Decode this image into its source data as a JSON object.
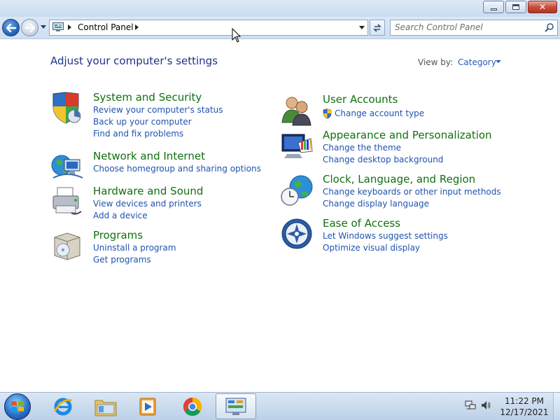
{
  "window": {
    "minimize_label": "",
    "maximize_label": "",
    "close_label": "✕"
  },
  "navbar": {
    "breadcrumb": "Control Panel",
    "search_placeholder": "Search Control Panel"
  },
  "content": {
    "heading": "Adjust your computer's settings",
    "view_by_label": "View by:",
    "view_by_value": "Category"
  },
  "categories_left": [
    {
      "title": "System and Security",
      "icon": "shield-icon",
      "links": [
        "Review your computer's status",
        "Back up your computer",
        "Find and fix problems"
      ]
    },
    {
      "title": "Network and Internet",
      "icon": "globe-network-icon",
      "links": [
        "Choose homegroup and sharing options"
      ]
    },
    {
      "title": "Hardware and Sound",
      "icon": "printer-icon",
      "links": [
        "View devices and printers",
        "Add a device"
      ]
    },
    {
      "title": "Programs",
      "icon": "programs-box-icon",
      "links": [
        "Uninstall a program",
        "Get programs"
      ]
    }
  ],
  "categories_right": [
    {
      "title": "User Accounts",
      "icon": "users-icon",
      "links": [
        "Change account type"
      ]
    },
    {
      "title": "Appearance and Personalization",
      "icon": "monitor-paint-icon",
      "links": [
        "Change the theme",
        "Change desktop background"
      ]
    },
    {
      "title": "Clock, Language, and Region",
      "icon": "clock-globe-icon",
      "links": [
        "Change keyboards or other input methods",
        "Change display language"
      ]
    },
    {
      "title": "Ease of Access",
      "icon": "ease-of-access-icon",
      "links": [
        "Let Windows suggest settings",
        "Optimize visual display"
      ]
    }
  ],
  "taskbar": {
    "time": "11:22 PM",
    "date": "12/17/2021",
    "apps": [
      "internet-explorer-icon",
      "windows-explorer-icon",
      "media-player-icon",
      "chrome-icon",
      "control-panel-icon"
    ]
  },
  "colors": {
    "heading": "#1e3287",
    "category_title": "#11700f",
    "link": "#1f53b0"
  }
}
